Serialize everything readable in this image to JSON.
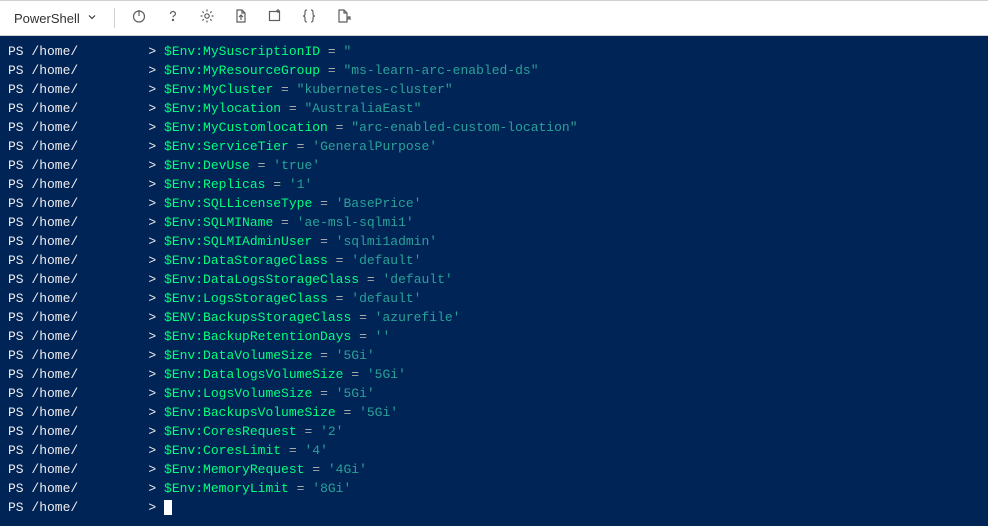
{
  "toolbar": {
    "shell_label": "PowerShell",
    "icons": {
      "power": "power-icon",
      "help": "help-icon",
      "settings": "gear-icon",
      "new_file": "new-file-icon",
      "upload": "upload-icon",
      "braces": "braces-icon",
      "new_tab": "new-tab-icon"
    }
  },
  "terminal": {
    "prompt_prefix": "PS ",
    "prompt_path": "/home/",
    "prompt_gt": ">",
    "lines": [
      {
        "var": "$Env:MySuscriptionID",
        "op": "=",
        "val": "\""
      },
      {
        "var": "$Env:MyResourceGroup",
        "op": "=",
        "val": "\"ms-learn-arc-enabled-ds\""
      },
      {
        "var": "$Env:MyCluster",
        "op": "=",
        "val": "\"kubernetes-cluster\""
      },
      {
        "var": "$Env:Mylocation",
        "op": "=",
        "val": "\"AustraliaEast\""
      },
      {
        "var": "$Env:MyCustomlocation",
        "op": "=",
        "val": "\"arc-enabled-custom-location\""
      },
      {
        "var": "$Env:ServiceTier",
        "op": "=",
        "val": "'GeneralPurpose'"
      },
      {
        "var": "$Env:DevUse",
        "op": "=",
        "val": "'true'"
      },
      {
        "var": "$Env:Replicas",
        "op": "=",
        "val": "'1'"
      },
      {
        "var": "$Env:SQLLicenseType",
        "op": "=",
        "val": "'BasePrice'"
      },
      {
        "var": "$Env:SQLMIName",
        "op": "=",
        "val": "'ae-msl-sqlmi1'"
      },
      {
        "var": "$Env:SQLMIAdminUser",
        "op": "=",
        "val": "'sqlmi1admin'"
      },
      {
        "var": "$Env:DataStorageClass",
        "op": "=",
        "val": "'default'"
      },
      {
        "var": "$Env:DataLogsStorageClass",
        "op": "=",
        "val": "'default'"
      },
      {
        "var": "$Env:LogsStorageClass",
        "op": "=",
        "val": "'default'"
      },
      {
        "var": "$ENV:BackupsStorageClass",
        "op": "=",
        "val": "'azurefile'"
      },
      {
        "var": "$Env:BackupRetentionDays",
        "op": "=",
        "val": "''"
      },
      {
        "var": "$Env:DataVolumeSize",
        "op": "=",
        "val": "'5Gi'"
      },
      {
        "var": "$Env:DatalogsVolumeSize",
        "op": "=",
        "val": "'5Gi'"
      },
      {
        "var": "$Env:LogsVolumeSize",
        "op": "=",
        "val": "'5Gi'"
      },
      {
        "var": "$Env:BackupsVolumeSize",
        "op": "=",
        "val": "'5Gi'"
      },
      {
        "var": "$Env:CoresRequest",
        "op": "=",
        "val": "'2'"
      },
      {
        "var": "$Env:CoresLimit",
        "op": "=",
        "val": "'4'"
      },
      {
        "var": "$Env:MemoryRequest",
        "op": "=",
        "val": "'4Gi'"
      },
      {
        "var": "$Env:MemoryLimit",
        "op": "=",
        "val": "'8Gi'"
      }
    ]
  }
}
